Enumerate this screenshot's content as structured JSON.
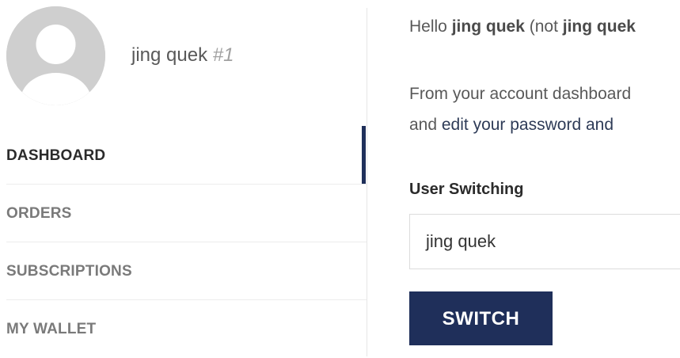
{
  "profile": {
    "name": "jing quek",
    "id": "#1"
  },
  "nav": {
    "items": [
      {
        "label": "DASHBOARD",
        "active": true
      },
      {
        "label": "ORDERS",
        "active": false
      },
      {
        "label": "SUBSCRIPTIONS",
        "active": false
      },
      {
        "label": "MY WALLET",
        "active": false
      }
    ]
  },
  "greeting": {
    "prefix": "Hello ",
    "name": "jing quek",
    "middle": " (not ",
    "name_not": "jing quek"
  },
  "intro": {
    "line1": "From your account dashboard",
    "line2_prefix": "and ",
    "line2_link": "edit your password and",
    "line2_suffix": ""
  },
  "user_switching": {
    "title": "User Switching",
    "field_value": "jing quek",
    "button_label": "SWITCH"
  },
  "colors": {
    "accent": "#1f2f5a",
    "avatar_bg": "#cfcfcf"
  }
}
